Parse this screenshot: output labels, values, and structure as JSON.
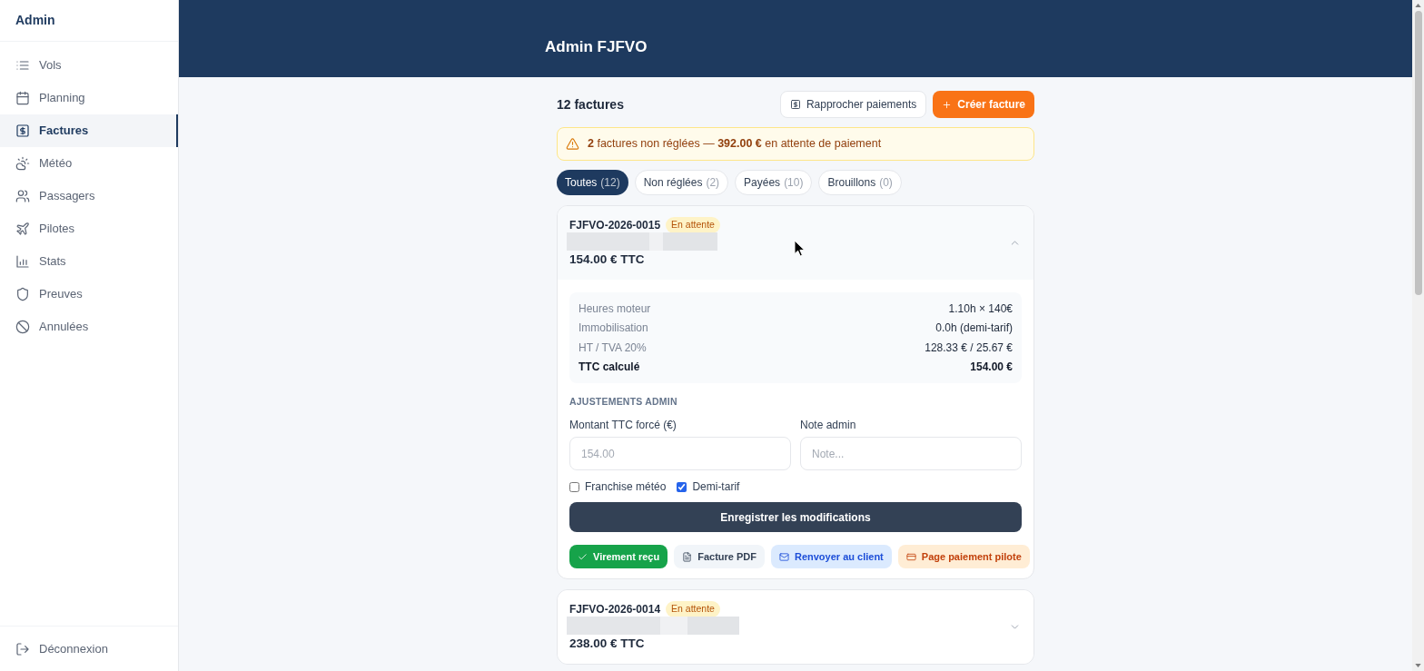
{
  "sidebar": {
    "title": "Admin",
    "items": [
      {
        "label": "Vols",
        "selected": false
      },
      {
        "label": "Planning",
        "selected": false
      },
      {
        "label": "Factures",
        "selected": true
      },
      {
        "label": "Météo",
        "selected": false
      },
      {
        "label": "Passagers",
        "selected": false
      },
      {
        "label": "Pilotes",
        "selected": false
      },
      {
        "label": "Stats",
        "selected": false
      },
      {
        "label": "Preuves",
        "selected": false
      },
      {
        "label": "Annulées",
        "selected": false
      }
    ],
    "footer_link": "Déconnexion"
  },
  "header": {
    "title": "Admin FJFVO"
  },
  "toolbar": {
    "count": "12 factures",
    "buttons": [
      {
        "label": "Rapprocher paiements",
        "kind": "secondary"
      },
      {
        "label": "Créer facture",
        "kind": "primary"
      }
    ]
  },
  "alert": {
    "text": "**2** factures non réglées — **392.00 €** en attente de paiement"
  },
  "tabs": [
    {
      "label": "Toutes",
      "count": "(12)",
      "selected": true
    },
    {
      "label": "Non réglées",
      "count": "(2)",
      "selected": false
    },
    {
      "label": "Payées",
      "count": "(10)",
      "selected": false
    },
    {
      "label": "Brouillons",
      "count": "(0)",
      "selected": false
    }
  ],
  "invoices": [
    {
      "number": "FJFVO-2026-0015",
      "status": "En attente",
      "amount": "154.00 € TTC",
      "expanded": true,
      "breakdown": [
        {
          "label": "Heures moteur",
          "value": "1.10h × 140€",
          "kind": "line"
        },
        {
          "label": "Immobilisation",
          "value": "0.0h (demi-tarif)",
          "kind": "line"
        },
        {
          "label": "HT / TVA 20%",
          "value": "128.33 € / 25.67 €",
          "kind": "line"
        },
        {
          "label": "TTC calculé",
          "value": "154.00 €",
          "kind": "total"
        }
      ],
      "adjustments": {
        "heading": "AJUSTEMENTS ADMIN",
        "fields": [
          {
            "label": "Montant TTC forcé (€)",
            "placeholder": "154.00"
          },
          {
            "label": "Note admin",
            "placeholder": "Note..."
          }
        ],
        "options": [
          {
            "label": "Franchise météo",
            "checked": false
          },
          {
            "label": "Demi-tarif",
            "checked": true
          }
        ],
        "save_button": "Enregistrer les modifications"
      },
      "actions": [
        {
          "label": "Virement reçu",
          "kind": "success"
        },
        {
          "label": "Facture PDF",
          "kind": "neutral"
        },
        {
          "label": "Renvoyer au client",
          "kind": "info"
        },
        {
          "label": "Page paiement pilote",
          "kind": "warning"
        }
      ]
    },
    {
      "number": "FJFVO-2026-0014",
      "status": "En attente",
      "amount": "238.00 € TTC",
      "expanded": false
    }
  ]
}
